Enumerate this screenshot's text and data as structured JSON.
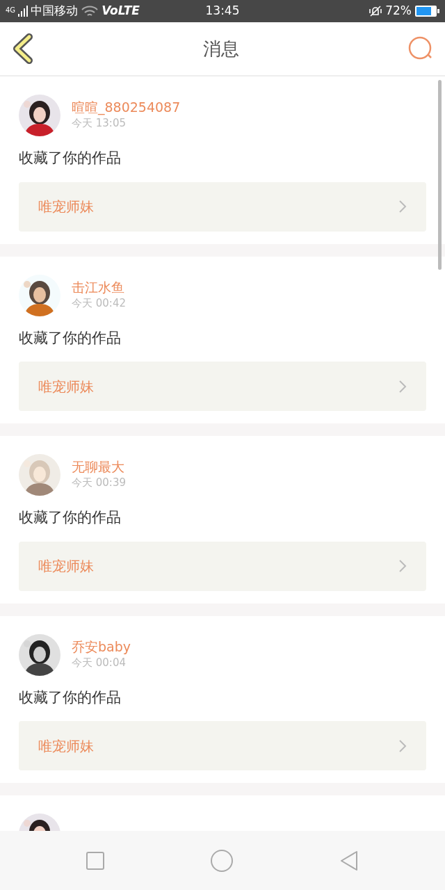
{
  "status_bar": {
    "signal": "4G",
    "carrier": "中国移动",
    "network": "VoLTE",
    "time": "13:45",
    "battery": "72%"
  },
  "header": {
    "title": "消息"
  },
  "messages": [
    {
      "kind": "full",
      "name": "暄暄_880254087",
      "time": "今天 13:05",
      "action": "收藏了你的作品",
      "work": "唯宠师妹"
    },
    {
      "kind": "full",
      "name": "击江水鱼",
      "time": "今天 00:42",
      "action": "收藏了你的作品",
      "work": "唯宠师妹"
    },
    {
      "kind": "full",
      "name": "无聊最大",
      "time": "今天 00:39",
      "action": "收藏了你的作品",
      "work": "唯宠师妹"
    },
    {
      "kind": "full",
      "name": "乔安baby",
      "time": "今天 00:04",
      "action": "收藏了你的作品",
      "work": "唯宠师妹"
    },
    {
      "kind": "cut"
    }
  ]
}
